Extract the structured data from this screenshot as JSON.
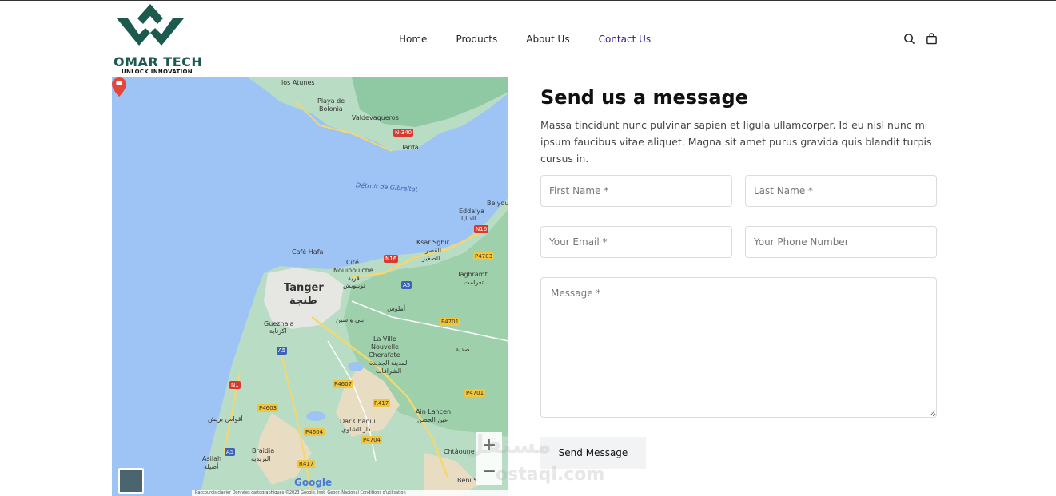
{
  "brand": {
    "name": "OMAR TECH",
    "tagline": "UNLOCK INNOVATION",
    "color": "#1c5a4e"
  },
  "nav": {
    "items": [
      {
        "label": "Home"
      },
      {
        "label": "Products"
      },
      {
        "label": "About Us"
      },
      {
        "label": "Contact Us"
      }
    ],
    "active_color": "#3b1e8c"
  },
  "header_icons": {
    "search": "search-icon",
    "cart": "cart-icon"
  },
  "map": {
    "places": {
      "los_atunes": "los Atunes",
      "playa_bolonia": "Playa de",
      "playa_bolonia2": "Bolonia",
      "valdevaqueros": "Valdevaqueros",
      "tarifa": "Tarifa",
      "strait": "Détroit de Gibraltat",
      "belyou": "Belyou",
      "eddalya": "Eddalya",
      "eddalya_ar": "الداليا",
      "ksar_sghir": "Ksar Sghir",
      "ksar_sghir_ar": "القصر",
      "ksar_sghir_ar2": "الصغير",
      "cafe_hafa": "Café Hafa",
      "cite_nouinouiche": "Cité",
      "cite_nouinouiche2": "Nouinouiche",
      "cite_ar": "قرية",
      "cite_ar2": "نوينويش",
      "tanger": "Tanger",
      "tanger_ar": "طنجة",
      "taghramt": "Taghramt",
      "taghramt_ar": "تغرامت",
      "aalouss": "أملوس",
      "guezn": "Gueznaia",
      "guezn_ar": "اكزناية",
      "beni_ouassine": "بني واسين",
      "laville": "La Ville",
      "nouvelle": "Nouvelle",
      "cherafate": "Cherafate",
      "cherafate_ar": "المدينة الجديدة",
      "cherafate_ar2": "الشرافات",
      "sedia": "صدية",
      "ain_lahcen": "Ain Lahcen",
      "ain_lahcen_ar": "عين الحصن",
      "aouafas": "أقواس بريش",
      "dar_chaoui": "Dar Chaoui",
      "dar_chaoui_ar": "دار الشاوي",
      "braidia": "Braidia",
      "braidia_ar": "البريدية",
      "asilah": "Asilah",
      "asilah_ar": "أصيلة",
      "chaouene": "Chtâoune",
      "beni_s": "Beni S"
    },
    "roads": {
      "n340": "N-340",
      "n16a": "N16",
      "n16b": "N16",
      "p4703": "P4703",
      "a5a": "A5",
      "a5b": "A5",
      "a5c": "A5",
      "p4701a": "P4701",
      "p4701b": "P4701",
      "p4607": "P4607",
      "n1": "N1",
      "p4603": "P4603",
      "r417a": "R417",
      "r417b": "R417",
      "p4604": "P4604",
      "p4704": "P4704"
    },
    "google": "Google",
    "attribution": "Raccourcis clavier     Données cartographiques ©2023 Google, Inst. Geogr. Nacional    Conditions d'utilisation",
    "zoom_in": "+",
    "zoom_out": "−"
  },
  "form": {
    "title": "Send us a message",
    "description": "Massa tincidunt nunc pulvinar sapien et ligula ullamcorper. Id eu nisl nunc mi ipsum faucibus vitae aliquet. Magna sit amet purus gravida quis blandit turpis cursus in.",
    "first_name_placeholder": "First Name *",
    "last_name_placeholder": "Last Name *",
    "email_placeholder": "Your Email *",
    "phone_placeholder": "Your Phone Number",
    "message_placeholder": "Message *",
    "submit_label": "Send Message"
  },
  "watermark": {
    "text": "مستقل",
    "text2": "ostaql.com"
  }
}
